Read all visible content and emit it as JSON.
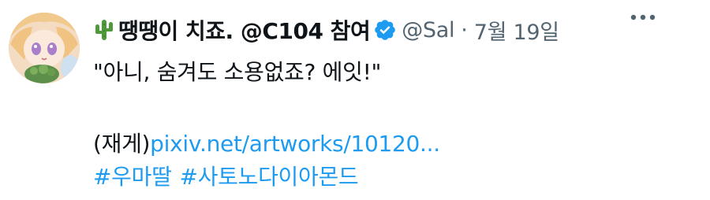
{
  "tweet": {
    "display_name": "땡땡이 치죠. @C104 참여",
    "handle": "@Sal",
    "separator": "·",
    "date": "7월 19일",
    "text_line1": "\"아니, 숨겨도 소용없죠? 에잇!\"",
    "prefix": "(재게)",
    "link": "pixiv.net/artworks/10120...",
    "hashtags": [
      "#우마딸",
      "#사토노다이아몬드"
    ]
  },
  "icons": {
    "name_emoji": "cactus-icon",
    "verified": "verified-badge-icon",
    "more": "more-options-icon"
  },
  "colors": {
    "text": "#0f1419",
    "secondary": "#536471",
    "link": "#1d9bf0",
    "verified": "#1d9bf0",
    "cactus": "#4e9a3a"
  }
}
